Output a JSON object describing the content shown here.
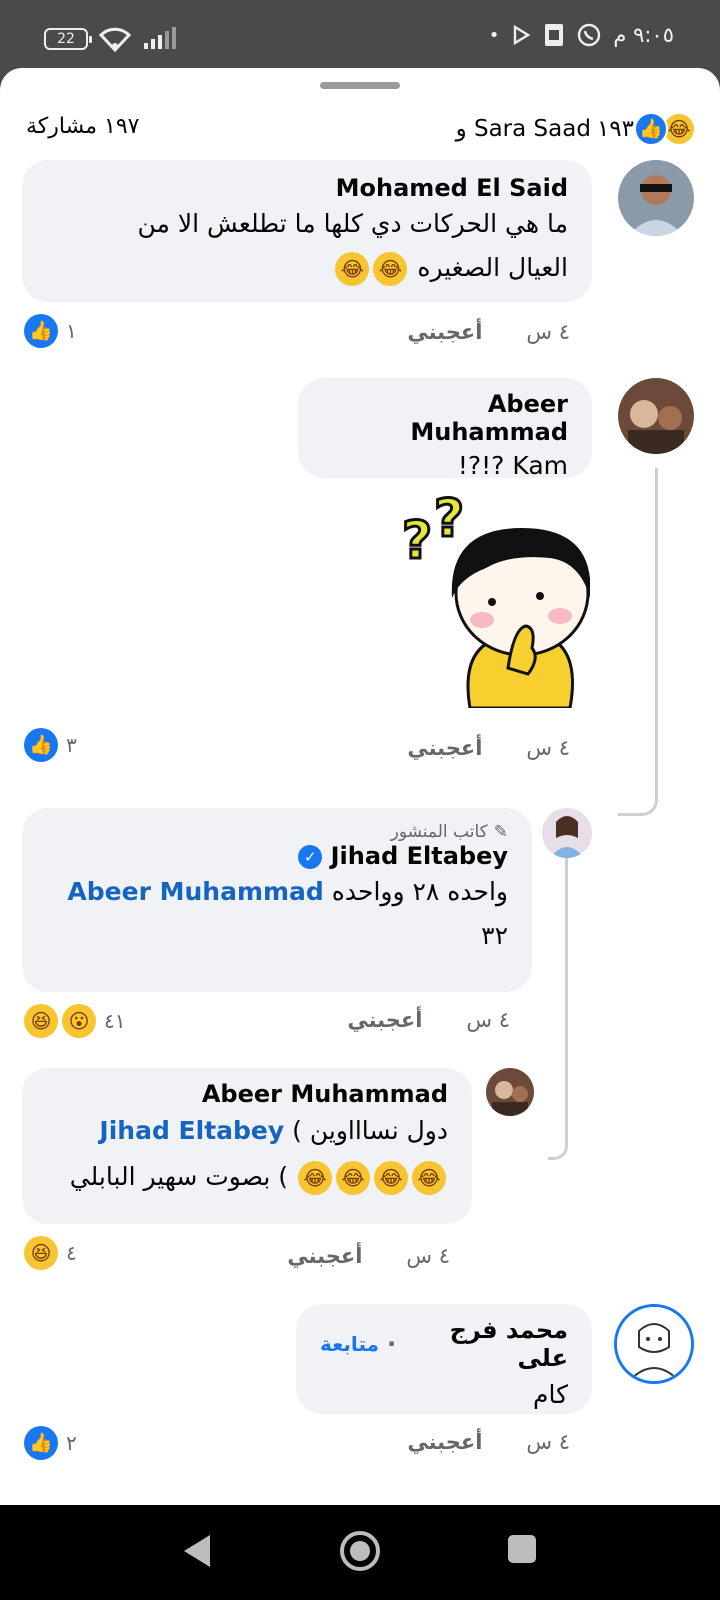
{
  "status": {
    "time": "٩:٠٥ م",
    "battery": "22",
    "dot": "•"
  },
  "sheet": {
    "reactions_count": "١٩٣",
    "reactions_prefix": "Sara Saad و",
    "shares": "١٩٧ مشاركة"
  },
  "comments": [
    {
      "name": "Mohamed El Said",
      "text_line1": "ما هي الحركات دي كلها ما تطلعش الا من",
      "text_line2": "العيال الصغيره",
      "time": "٤ س",
      "like": "أعجبني",
      "reaction_count": "١"
    },
    {
      "name": "Abeer Muhammad",
      "text": "Kam ?!?!",
      "time": "٤ س",
      "like": "أعجبني",
      "reaction_count": "٣"
    },
    {
      "author_tag": "كاتب المنشور",
      "name": "Jihad Eltabey",
      "text_prefix": "واحده ٢٨ وواحده",
      "mention": "Abeer Muhammad",
      "text_line2": "٣٢",
      "time": "٤ س",
      "like": "أعجبني",
      "reaction_count": "٤١"
    },
    {
      "name": "Abeer Muhammad",
      "mention": "Jihad Eltabey",
      "text_line1": "دول نساااوين )",
      "text_line2": ") بصوت سهير البابلي",
      "time": "٤ س",
      "like": "أعجبني",
      "reaction_count": "٤"
    },
    {
      "name": "محمد فرج على",
      "follow": "متابعة",
      "text": "كام",
      "time": "٤ س",
      "like": "أعجبني",
      "reaction_count": "٢"
    }
  ],
  "icons": {
    "like": "like-icon",
    "haha": "haha-icon",
    "wow": "wow-icon"
  },
  "colors": {
    "accent": "#1877f2",
    "bubble": "#f0f2f5",
    "meta": "#65676b"
  }
}
